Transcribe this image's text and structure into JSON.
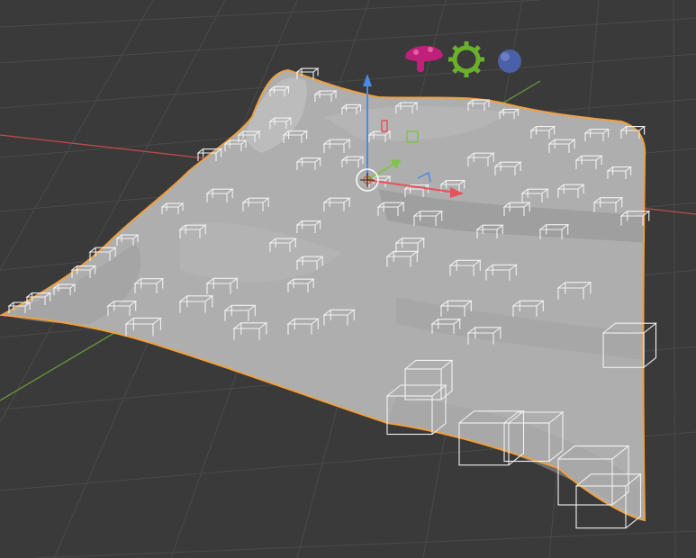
{
  "viewport": {
    "background": "#3a3a3a",
    "grid_color": "#4a4a4a",
    "axis_x_color": "#c04a4a",
    "axis_y_color": "#6a9a3a"
  },
  "terrain": {
    "fill": "#aeaeae",
    "outline_color": "#f0a040",
    "selected": true
  },
  "instances": {
    "wire_color": "#f2f2f2",
    "shape": "table-cube-wireframe"
  },
  "gizmo": {
    "x_color": "#e8505a",
    "y_color": "#7ec44a",
    "z_color": "#4a8ae8",
    "origin_icon": "object-origin-icon"
  },
  "source_objects": [
    {
      "name": "mushroom-icon",
      "color": "#c0207a"
    },
    {
      "name": "gear-icon",
      "color": "#6ab02a"
    },
    {
      "name": "sphere-icon",
      "color": "#4a60a8"
    }
  ]
}
